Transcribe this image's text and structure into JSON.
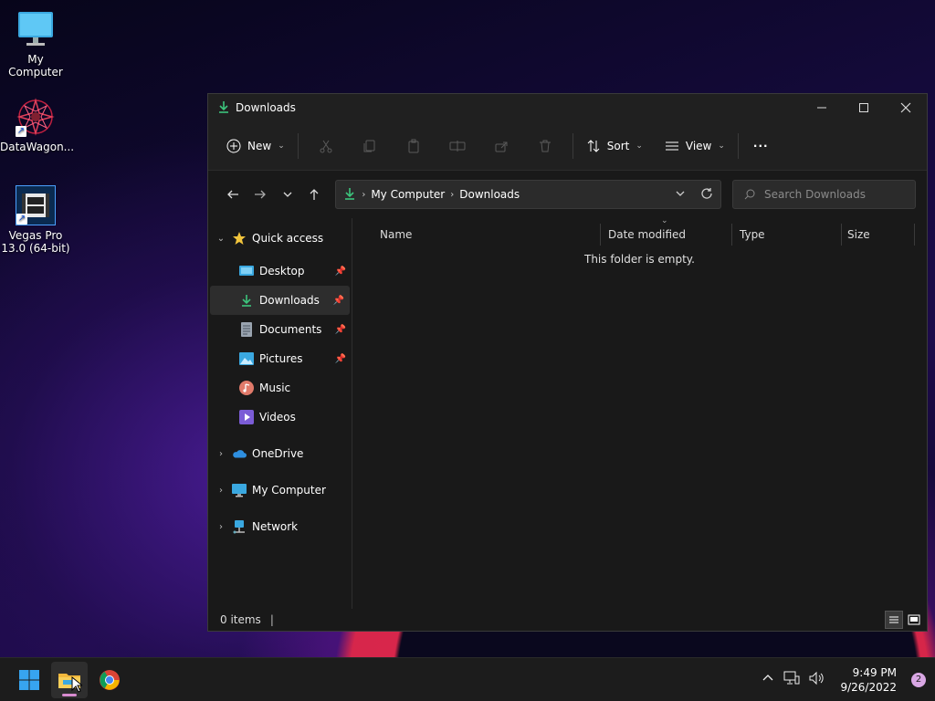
{
  "desktop": {
    "icons": [
      {
        "label": "My Computer"
      },
      {
        "label": "DataWagon..."
      },
      {
        "label": "Vegas Pro 13.0 (64-bit)"
      }
    ]
  },
  "window": {
    "title": "Downloads",
    "controls": {
      "minimize": "minimize-icon",
      "maximize": "maximize-icon",
      "close": "close-icon"
    }
  },
  "toolbar": {
    "new_label": "New",
    "sort_label": "Sort",
    "view_label": "View"
  },
  "address": {
    "crumbs": [
      "My Computer",
      "Downloads"
    ]
  },
  "search": {
    "placeholder": "Search Downloads"
  },
  "sidebar": {
    "quick_access": "Quick access",
    "items": [
      {
        "label": "Desktop",
        "pinned": true
      },
      {
        "label": "Downloads",
        "pinned": true,
        "selected": true
      },
      {
        "label": "Documents",
        "pinned": true
      },
      {
        "label": "Pictures",
        "pinned": true
      },
      {
        "label": "Music",
        "pinned": false
      },
      {
        "label": "Videos",
        "pinned": false
      }
    ],
    "onedrive": "OneDrive",
    "my_computer": "My Computer",
    "network": "Network"
  },
  "columns": {
    "name": "Name",
    "date": "Date modified",
    "type": "Type",
    "size": "Size"
  },
  "empty_message": "This folder is empty.",
  "status": {
    "items": "0 items"
  },
  "taskbar": {
    "time": "9:49 PM",
    "date": "9/26/2022",
    "notifications": "2"
  },
  "colors": {
    "accent_green": "#3cc47c",
    "window_bg": "#191919",
    "taskbar_bg": "#1c1c1c"
  }
}
